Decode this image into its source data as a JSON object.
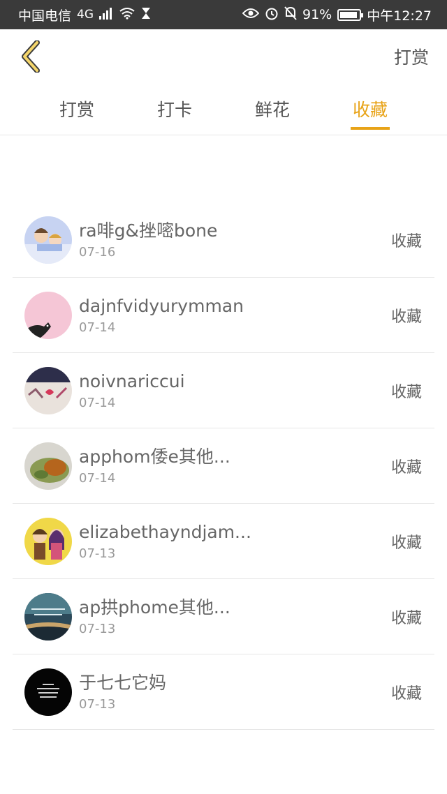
{
  "status_bar": {
    "carrier": "中国电信",
    "network": "4G",
    "battery": "91%",
    "time": "中午12:27"
  },
  "header": {
    "right_label": "打赏"
  },
  "tabs": [
    {
      "label": "打赏",
      "active": false
    },
    {
      "label": "打卡",
      "active": false
    },
    {
      "label": "鲜花",
      "active": false
    },
    {
      "label": "收藏",
      "active": true
    }
  ],
  "accent_color": "#e8a317",
  "list": [
    {
      "name": "ra啡g&挫嘧bone",
      "date": "07-16",
      "action": "收藏"
    },
    {
      "name": "dajnfvidyurymman",
      "date": "07-14",
      "action": "收藏"
    },
    {
      "name": "noivnariccui",
      "date": "07-14",
      "action": "收藏"
    },
    {
      "name": "apphom倭e其他...",
      "date": "07-14",
      "action": "收藏"
    },
    {
      "name": "elizabethayndjam...",
      "date": "07-13",
      "action": "收藏"
    },
    {
      "name": "ap拱phome其他...",
      "date": "07-13",
      "action": "收藏"
    },
    {
      "name": "于七七它妈",
      "date": "07-13",
      "action": "收藏"
    }
  ]
}
